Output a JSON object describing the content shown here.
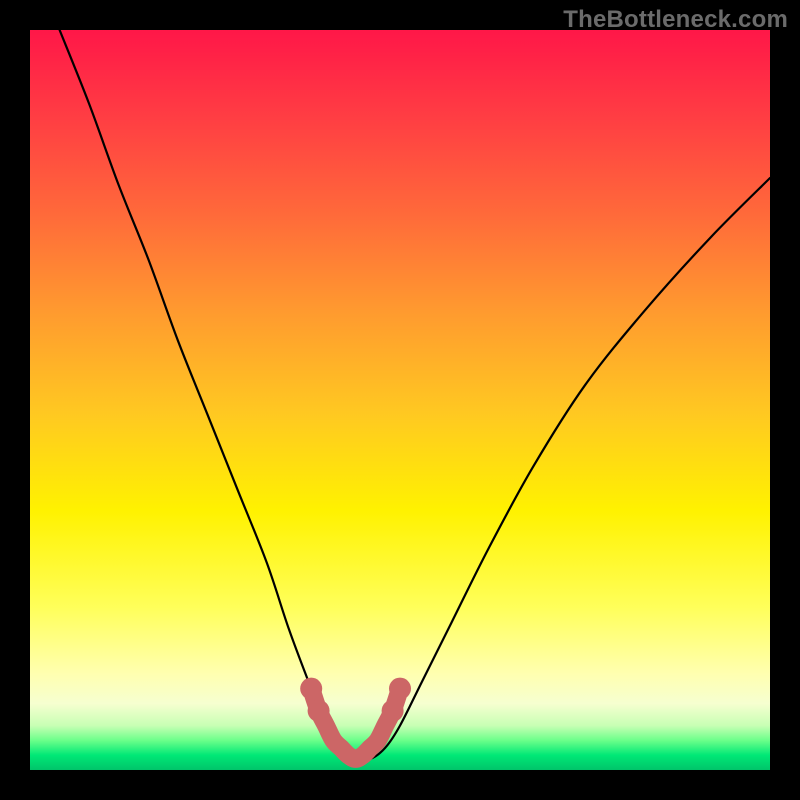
{
  "watermark": "TheBottleneck.com",
  "chart_data": {
    "type": "line",
    "title": "",
    "xlabel": "",
    "ylabel": "",
    "xlim": [
      0,
      100
    ],
    "ylim": [
      0,
      100
    ],
    "grid": false,
    "series": [
      {
        "name": "bottleneck-curve",
        "color": "#000000",
        "x": [
          4,
          8,
          12,
          16,
          20,
          24,
          28,
          32,
          35,
          38,
          40,
          42,
          44,
          46,
          48,
          50,
          53,
          57,
          62,
          68,
          75,
          83,
          92,
          100
        ],
        "y": [
          100,
          90,
          79,
          69,
          58,
          48,
          38,
          28,
          19,
          11,
          6,
          3,
          1.5,
          1.5,
          3,
          6,
          12,
          20,
          30,
          41,
          52,
          62,
          72,
          80
        ]
      },
      {
        "name": "optimal-zone-marker",
        "color": "#cc6666",
        "x": [
          38,
          39,
          40,
          41,
          42,
          43,
          44,
          45,
          46,
          47,
          48,
          49,
          50
        ],
        "y": [
          11,
          8,
          6,
          4,
          3,
          2,
          1.5,
          2,
          3,
          4,
          6,
          8,
          11
        ]
      }
    ],
    "gradient_bands": [
      {
        "pos": 0.0,
        "color": "#ff1748"
      },
      {
        "pos": 0.12,
        "color": "#ff3e43"
      },
      {
        "pos": 0.25,
        "color": "#ff6a3a"
      },
      {
        "pos": 0.38,
        "color": "#ff9a2f"
      },
      {
        "pos": 0.52,
        "color": "#ffc921"
      },
      {
        "pos": 0.65,
        "color": "#fff200"
      },
      {
        "pos": 0.78,
        "color": "#ffff5a"
      },
      {
        "pos": 0.87,
        "color": "#ffffb0"
      },
      {
        "pos": 0.91,
        "color": "#f6ffd0"
      },
      {
        "pos": 0.94,
        "color": "#c8ffb4"
      },
      {
        "pos": 0.96,
        "color": "#6bff8a"
      },
      {
        "pos": 0.98,
        "color": "#00e876"
      },
      {
        "pos": 1.0,
        "color": "#00c46a"
      }
    ]
  }
}
